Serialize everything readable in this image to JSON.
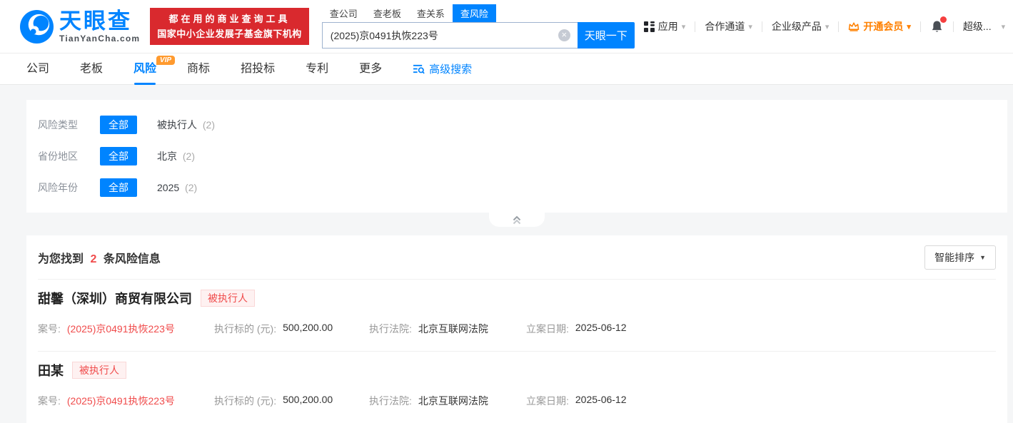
{
  "header": {
    "logo": {
      "title": "天眼查",
      "subtitle": "TianYanCha.com"
    },
    "banner": {
      "line1": "都在用的商业查询工具",
      "line2": "国家中小企业发展子基金旗下机构"
    },
    "search": {
      "tabs": [
        {
          "label": "查公司"
        },
        {
          "label": "查老板"
        },
        {
          "label": "查关系"
        },
        {
          "label": "查风险"
        }
      ],
      "active_tab": "查风险",
      "value": "(2025)京0491执恢223号",
      "button": "天眼一下"
    },
    "nav": {
      "apps": "应用",
      "coop": "合作通道",
      "enterprise": "企业级产品",
      "vip": "开通会员",
      "super": "超级..."
    }
  },
  "tabs": {
    "items": [
      {
        "label": "公司"
      },
      {
        "label": "老板"
      },
      {
        "label": "风险",
        "badge": "VIP"
      },
      {
        "label": "商标"
      },
      {
        "label": "招投标"
      },
      {
        "label": "专利"
      },
      {
        "label": "更多"
      }
    ],
    "active": "风险",
    "advanced": "高级搜索"
  },
  "filters": [
    {
      "label": "风险类型",
      "all": "全部",
      "option": {
        "name": "被执行人",
        "count": "(2)"
      }
    },
    {
      "label": "省份地区",
      "all": "全部",
      "option": {
        "name": "北京",
        "count": "(2)"
      }
    },
    {
      "label": "风险年份",
      "all": "全部",
      "option": {
        "name": "2025",
        "count": "(2)"
      }
    }
  ],
  "results": {
    "summary": {
      "prefix": "为您找到",
      "count": "2",
      "suffix": "条风险信息"
    },
    "sort_label": "智能排序",
    "items": [
      {
        "title": "甜馨（深圳）商贸有限公司",
        "badge": "被执行人",
        "fields": [
          {
            "label": "案号:",
            "value": "(2025)京0491执恢223号"
          },
          {
            "label": "执行标的 (元):",
            "value": "500,200.00"
          },
          {
            "label": "执行法院:",
            "value": "北京互联网法院"
          },
          {
            "label": "立案日期:",
            "value": "2025-06-12"
          }
        ]
      },
      {
        "title": "田某",
        "badge": "被执行人",
        "fields": [
          {
            "label": "案号:",
            "value": "(2025)京0491执恢223号"
          },
          {
            "label": "执行标的 (元):",
            "value": "500,200.00"
          },
          {
            "label": "执行法院:",
            "value": "北京互联网法院"
          },
          {
            "label": "立案日期:",
            "value": "2025-06-12"
          }
        ]
      }
    ]
  },
  "glyphs": {
    "caret_down": "▾",
    "sort_caret": "▼",
    "clear": "×"
  },
  "colors": {
    "accent": "#0084ff",
    "banner_red": "#d9292e",
    "risk_red": "#f04b4b",
    "vip_orange": "#ff8000"
  }
}
